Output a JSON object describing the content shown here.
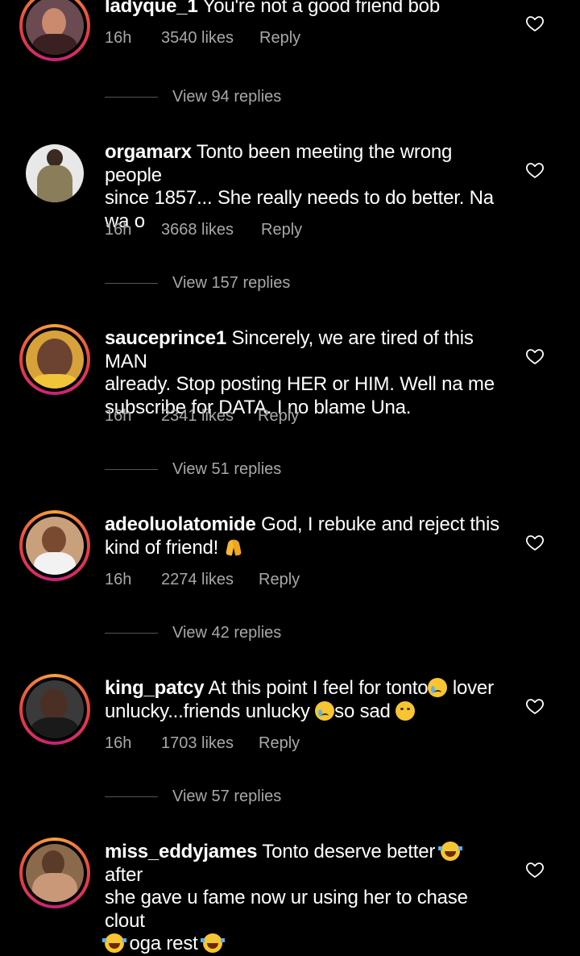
{
  "comments": [
    {
      "username": "ladyque_1",
      "text": "You're not a good friend bob",
      "time": "16h",
      "likes": "3540 likes",
      "reply": "Reply",
      "view_replies": "View 94 replies"
    },
    {
      "username": "orgamarx",
      "text_lines": [
        "Tonto been meeting the wrong people",
        "since 1857... She really needs to do better. Na",
        "wa o"
      ],
      "time": "16h",
      "likes": "3668 likes",
      "reply": "Reply",
      "view_replies": "View 157 replies"
    },
    {
      "username": "sauceprince1",
      "text_lines": [
        "Sincerely, we are tired of this MAN",
        "already. Stop posting HER or HIM. Well na me",
        "subscribe for DATA. I no blame Una."
      ],
      "time": "16h",
      "likes": "2341 likes",
      "reply": "Reply",
      "view_replies": "View 51 replies"
    },
    {
      "username": "adeoluolatomide",
      "text_lines": [
        "God, I rebuke and reject this",
        "kind of friend!"
      ],
      "emoji": "folded-hands",
      "time": "16h",
      "likes": "2274 likes",
      "reply": "Reply",
      "view_replies": "View 42 replies"
    },
    {
      "username": "king_patcy",
      "text_a": "At this point I feel for tonto",
      "text_b": " lover",
      "text_c": "unlucky...friends unlucky ",
      "text_d": "so sad ",
      "time": "16h",
      "likes": "1703 likes",
      "reply": "Reply",
      "view_replies": "View 57 replies"
    },
    {
      "username": "miss_eddyjames",
      "text_a": "Tonto deserve better ",
      "text_b": " after",
      "text_c": "she gave u fame now ur using her to chase clout",
      "text_d": " oga rest ",
      "emoji": "face-with-tears-of-joy"
    }
  ],
  "icons": {
    "like": "heart-outline-icon"
  },
  "colors": {
    "background": "#000000",
    "text": "#ffffff",
    "secondary_text": "#a8a8a8",
    "story_ring_start": "#f9a33a",
    "story_ring_end": "#c8207a"
  }
}
